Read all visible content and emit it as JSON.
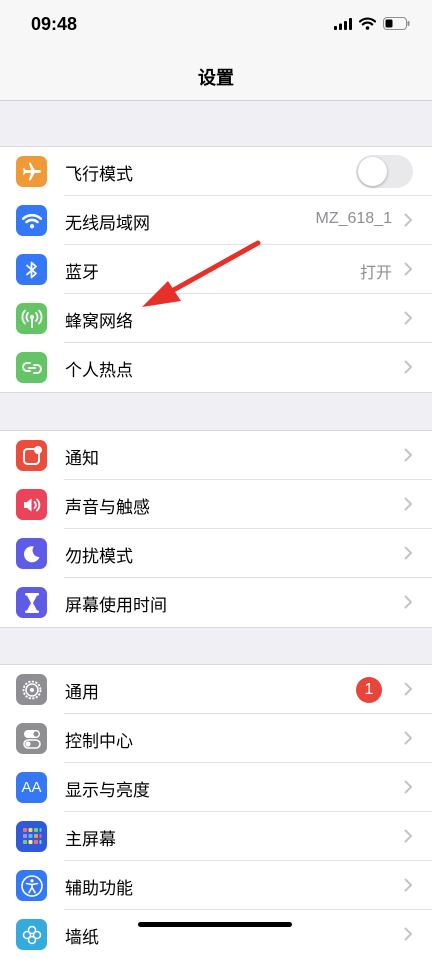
{
  "status": {
    "time": "09:48"
  },
  "nav": {
    "title": "设置"
  },
  "groups": [
    {
      "items": [
        {
          "label": "飞行模式",
          "icon": "airplane-icon",
          "color": "#f09a37",
          "toggle": false
        },
        {
          "label": "无线局域网",
          "icon": "wifi-icon",
          "color": "#3478f6",
          "value": "MZ_618_1"
        },
        {
          "label": "蓝牙",
          "icon": "bluetooth-icon",
          "color": "#3478f6",
          "value": "打开"
        },
        {
          "label": "蜂窝网络",
          "icon": "cellular-icon",
          "color": "#65c466"
        },
        {
          "label": "个人热点",
          "icon": "hotspot-icon",
          "color": "#65c466"
        }
      ]
    },
    {
      "items": [
        {
          "label": "通知",
          "icon": "notifications-icon",
          "color": "#eb4d3d"
        },
        {
          "label": "声音与触感",
          "icon": "sound-icon",
          "color": "#eb445a"
        },
        {
          "label": "勿扰模式",
          "icon": "moon-icon",
          "color": "#5e5ce6"
        },
        {
          "label": "屏幕使用时间",
          "icon": "hourglass-icon",
          "color": "#5e5ce6"
        }
      ]
    },
    {
      "items": [
        {
          "label": "通用",
          "icon": "gear-icon",
          "color": "#8e8e93",
          "badge": "1"
        },
        {
          "label": "控制中心",
          "icon": "toggles-icon",
          "color": "#8e8e93"
        },
        {
          "label": "显示与亮度",
          "icon": "text-size-icon",
          "color": "#3478f6",
          "icon_text": "AA"
        },
        {
          "label": "主屏幕",
          "icon": "home-screen-icon",
          "color": "#2f5ad9"
        },
        {
          "label": "辅助功能",
          "icon": "accessibility-icon",
          "color": "#3478f6"
        },
        {
          "label": "墙纸",
          "icon": "wallpaper-icon",
          "color": "#35aadc"
        }
      ]
    }
  ]
}
